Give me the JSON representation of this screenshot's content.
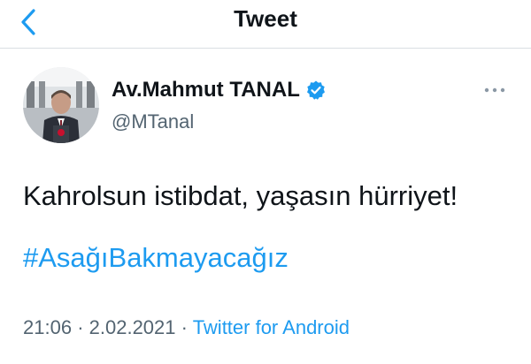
{
  "header": {
    "title": "Tweet",
    "back_icon": "chevron-left-icon"
  },
  "colors": {
    "accent": "#1d9bf0",
    "text_primary": "#0f1419",
    "text_secondary": "#536471"
  },
  "tweet": {
    "author": {
      "display_name": "Av.Mahmut TANAL",
      "handle": "@MTanal",
      "verified": true,
      "verified_icon": "verified-badge-icon"
    },
    "more_icon": "more-dots-icon",
    "text": "Kahrolsun istibdat, yaşasın hürriyet!",
    "hashtag": "#AsağıBakmayacağız",
    "time": "21:06",
    "separator": "·",
    "date": "2.02.2021",
    "source": "Twitter for Android"
  }
}
